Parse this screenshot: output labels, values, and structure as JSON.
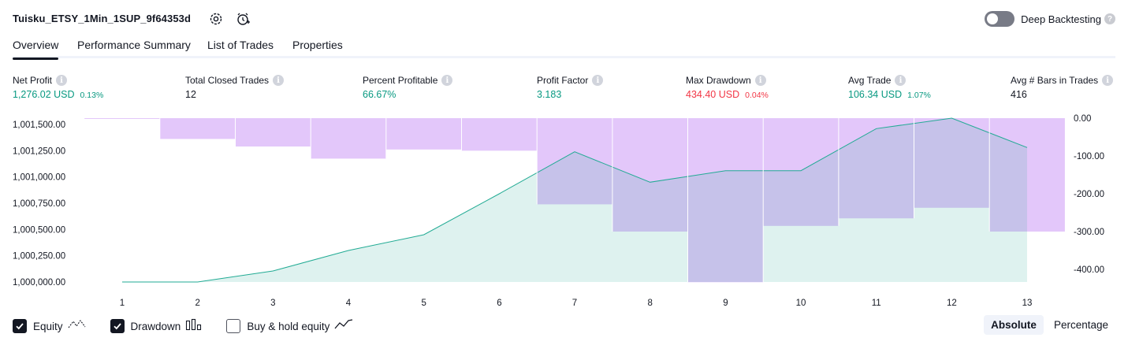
{
  "header": {
    "title": "Tuisku_ETSY_1Min_1SUP_9f64353d",
    "settings_icon": "gear-icon",
    "alert_icon": "add-alert-icon",
    "deep_backtesting_label": "Deep Backtesting",
    "deep_backtesting_enabled": false,
    "help_icon": "?"
  },
  "tabs": [
    {
      "label": "Overview",
      "active": true
    },
    {
      "label": "Performance Summary",
      "active": false
    },
    {
      "label": "List of Trades",
      "active": false
    },
    {
      "label": "Properties",
      "active": false
    }
  ],
  "metrics": [
    {
      "label": "Net Profit",
      "value": "1,276.02 USD",
      "sub": "0.13%",
      "color": "green"
    },
    {
      "label": "Total Closed Trades",
      "value": "12",
      "sub": "",
      "color": "dark"
    },
    {
      "label": "Percent Profitable",
      "value": "66.67%",
      "sub": "",
      "color": "green"
    },
    {
      "label": "Profit Factor",
      "value": "3.183",
      "sub": "",
      "color": "green"
    },
    {
      "label": "Max Drawdown",
      "value": "434.40 USD",
      "sub": "0.04%",
      "color": "red"
    },
    {
      "label": "Avg Trade",
      "value": "106.34 USD",
      "sub": "1.07%",
      "color": "green"
    },
    {
      "label": "Avg # Bars in Trades",
      "value": "416",
      "sub": "",
      "color": "dark"
    }
  ],
  "info_icon": "i",
  "colors": {
    "equity_line": "#22ab94",
    "equity_fill": "#e0f3ee",
    "drawdown_fill": "#e1c4fa",
    "green": "#089981",
    "red": "#f23645"
  },
  "chart_data": {
    "type": "area",
    "x": [
      1,
      2,
      3,
      4,
      5,
      6,
      7,
      8,
      9,
      10,
      11,
      12,
      13
    ],
    "left_axis": {
      "ticks": [
        "1,001,500.00",
        "1,001,250.00",
        "1,001,000.00",
        "1,000,750.00",
        "1,000,500.00",
        "1,000,250.00",
        "1,000,000.00"
      ],
      "ylim": [
        1000000,
        1001550
      ]
    },
    "right_axis": {
      "ticks": [
        "0.00",
        "-100.00",
        "-200.00",
        "-300.00",
        "-400.00"
      ],
      "ylim": [
        -440,
        0
      ]
    },
    "series": [
      {
        "name": "Equity",
        "type": "area",
        "axis": "left",
        "x": [
          1,
          2,
          3,
          4,
          5,
          6,
          7,
          8,
          9,
          10,
          11,
          12,
          13
        ],
        "values": [
          1000000,
          1000000,
          1000105,
          1000300,
          1000450,
          1000840,
          1001240,
          1000950,
          1001060,
          1001060,
          1001460,
          1001560,
          1001280
        ]
      },
      {
        "name": "Drawdown",
        "type": "bar",
        "axis": "right",
        "x": [
          1,
          2,
          3,
          4,
          5,
          6,
          7,
          8,
          9,
          10,
          11,
          12,
          13
        ],
        "values": [
          -2,
          -55,
          -75,
          -107,
          -83,
          -86,
          -228,
          -300,
          -434,
          -285,
          -265,
          -237,
          -300
        ]
      }
    ],
    "grid": false
  },
  "legend": [
    {
      "label": "Equity",
      "checked": true,
      "icon": "equity-line-icon"
    },
    {
      "label": "Drawdown",
      "checked": true,
      "icon": "drawdown-bars-icon"
    },
    {
      "label": "Buy & hold equity",
      "checked": false,
      "icon": "buy-hold-line-icon"
    }
  ],
  "scale_toggle": {
    "options": [
      "Absolute",
      "Percentage"
    ],
    "selected": "Absolute"
  }
}
